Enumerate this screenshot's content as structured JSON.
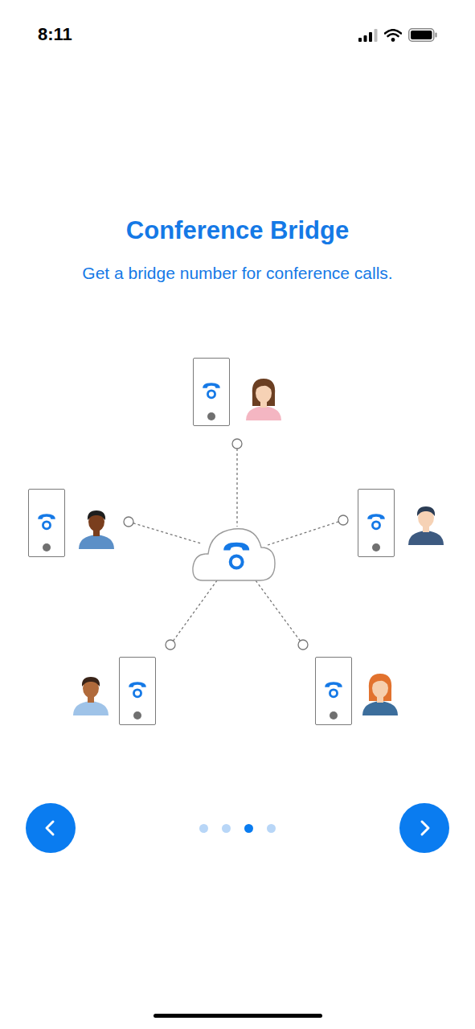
{
  "status_bar": {
    "time": "8:11"
  },
  "title": "Conference Bridge",
  "subtitle": "Get a bridge number for conference calls.",
  "participants": [
    {
      "color": "#f4b6c2"
    },
    {
      "color": "#5b8fc7"
    },
    {
      "color": "#3d5a80"
    },
    {
      "color": "#9fc3e8"
    },
    {
      "color": "#3c6e9c"
    }
  ],
  "pager": {
    "pages": [
      {
        "selected": false
      },
      {
        "selected": false
      },
      {
        "selected": true
      },
      {
        "selected": false
      }
    ]
  }
}
